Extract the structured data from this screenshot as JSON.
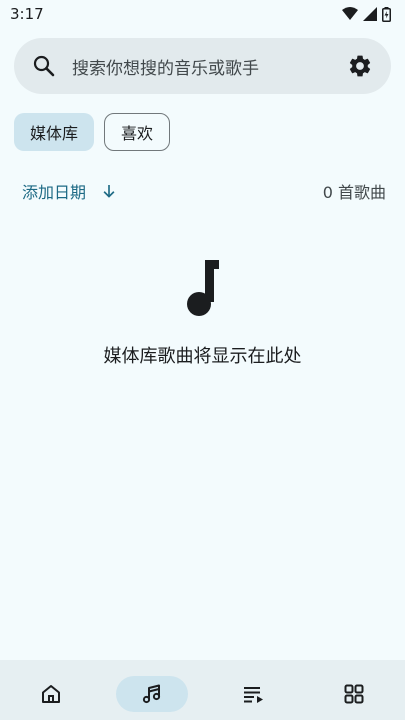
{
  "status_bar": {
    "time": "3:17"
  },
  "search": {
    "placeholder": "搜索你想搜的音乐或歌手"
  },
  "chips": [
    {
      "label": "媒体库",
      "selected": true
    },
    {
      "label": "喜欢",
      "selected": false
    }
  ],
  "sort": {
    "label": "添加日期",
    "direction": "descending",
    "count_label": "0 首歌曲"
  },
  "empty_state": {
    "message": "媒体库歌曲将显示在此处"
  },
  "bottom_nav": {
    "items": [
      {
        "icon": "home-icon"
      },
      {
        "icon": "music-library-icon",
        "active": true
      },
      {
        "icon": "playlist-icon"
      },
      {
        "icon": "grid-apps-icon"
      }
    ]
  },
  "colors": {
    "background": "#f3fbfd",
    "search_bg": "#e2eaed",
    "chip_selected": "#cde4ee",
    "accent": "#1d6a85",
    "nav_bg": "#e6eff2"
  }
}
